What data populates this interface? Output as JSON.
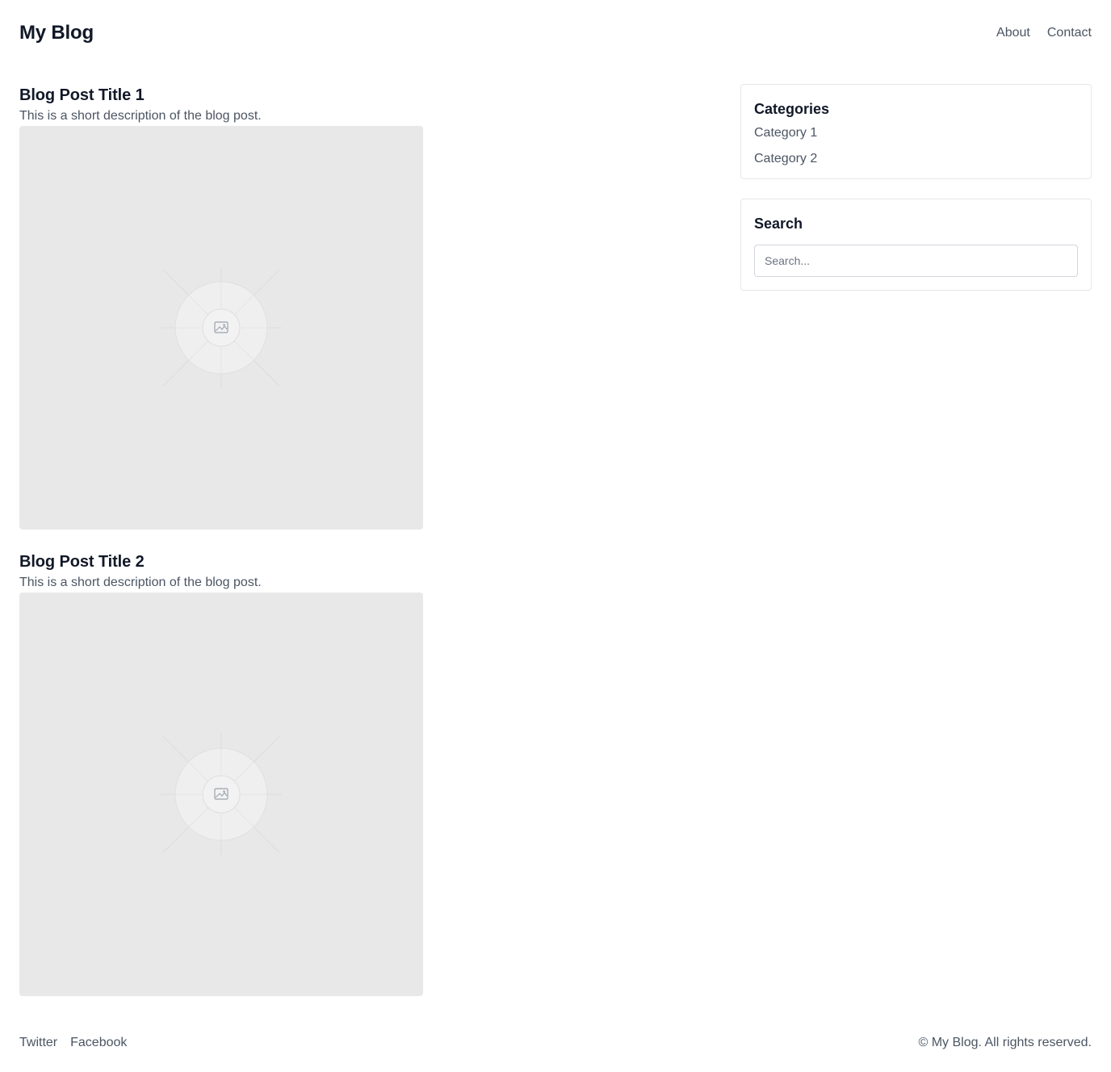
{
  "header": {
    "site_title": "My Blog",
    "nav": [
      {
        "label": "About"
      },
      {
        "label": "Contact"
      }
    ]
  },
  "posts": [
    {
      "title": "Blog Post Title 1",
      "description": "This is a short description of the blog post.",
      "image_icon": "image-placeholder-icon"
    },
    {
      "title": "Blog Post Title 2",
      "description": "This is a short description of the blog post.",
      "image_icon": "image-placeholder-icon"
    }
  ],
  "sidebar": {
    "categories": {
      "title": "Categories",
      "items": [
        {
          "label": "Category 1"
        },
        {
          "label": "Category 2"
        }
      ]
    },
    "search": {
      "title": "Search",
      "placeholder": "Search..."
    }
  },
  "footer": {
    "social": [
      {
        "label": "Twitter"
      },
      {
        "label": "Facebook"
      }
    ],
    "copyright": "© My Blog. All rights reserved."
  },
  "colors": {
    "text_primary": "#111827",
    "text_secondary": "#4b5563",
    "border": "#e5e7eb",
    "image_bg": "#e8e8e8"
  }
}
